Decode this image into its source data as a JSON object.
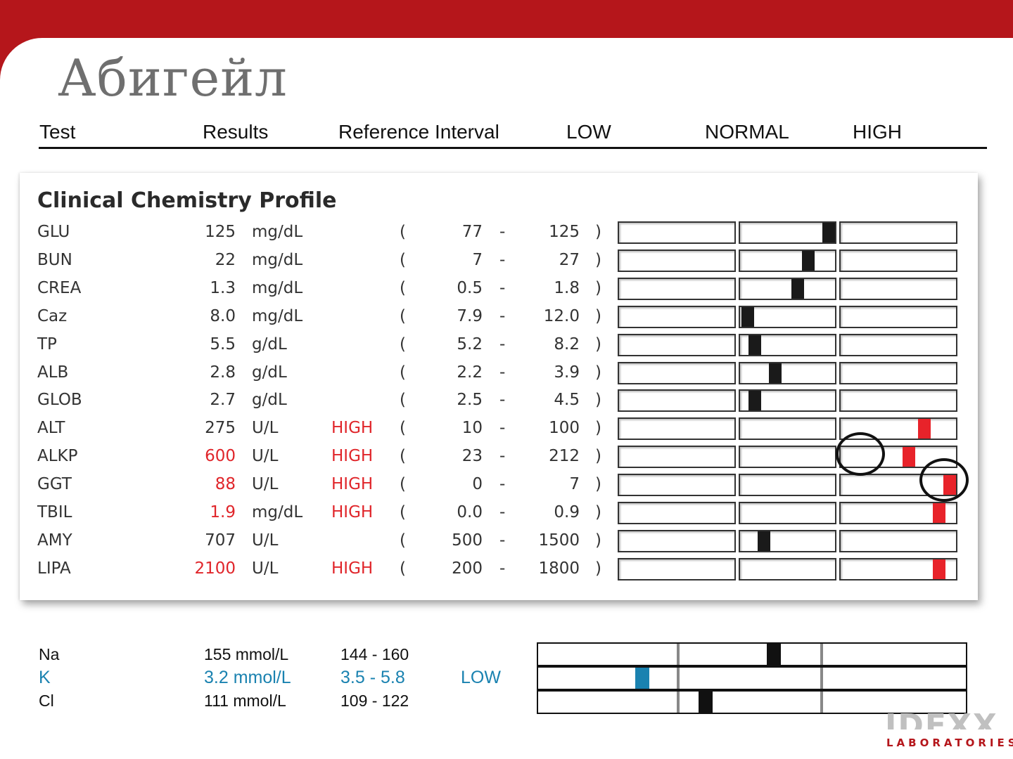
{
  "title": "Абигейл",
  "header": {
    "test": "Test",
    "results": "Results",
    "reference": "Reference Interval",
    "low": "LOW",
    "normal": "NORMAL",
    "high": "HIGH"
  },
  "profile": {
    "title": "Clinical Chemistry Profile",
    "rows": [
      {
        "test": "GLU",
        "result": "125",
        "unit": "mg/dL",
        "flag": "",
        "ref_open": "(",
        "ref_low": "77",
        "ref_dash": "-",
        "ref_high": "125",
        "ref_close": ")",
        "result_high": false,
        "level": 1.0
      },
      {
        "test": "BUN",
        "result": "22",
        "unit": "mg/dL",
        "flag": "",
        "ref_open": "(",
        "ref_low": "7",
        "ref_dash": "-",
        "ref_high": "27",
        "ref_close": ")",
        "result_high": false,
        "level": 0.75
      },
      {
        "test": "CREA",
        "result": "1.3",
        "unit": "mg/dL",
        "flag": "",
        "ref_open": "(",
        "ref_low": "0.5",
        "ref_dash": "-",
        "ref_high": "1.8",
        "ref_close": ")",
        "result_high": false,
        "level": 0.62
      },
      {
        "test": "Caz",
        "result": "8.0",
        "unit": "mg/dL",
        "flag": "",
        "ref_open": "(",
        "ref_low": "7.9",
        "ref_dash": "-",
        "ref_high": "12.0",
        "ref_close": ")",
        "result_high": false,
        "level": 0.02
      },
      {
        "test": "TP",
        "result": "5.5",
        "unit": "g/dL",
        "flag": "",
        "ref_open": "(",
        "ref_low": "5.2",
        "ref_dash": "-",
        "ref_high": "8.2",
        "ref_close": ")",
        "result_high": false,
        "level": 0.1
      },
      {
        "test": "ALB",
        "result": "2.8",
        "unit": "g/dL",
        "flag": "",
        "ref_open": "(",
        "ref_low": "2.2",
        "ref_dash": "-",
        "ref_high": "3.9",
        "ref_close": ")",
        "result_high": false,
        "level": 0.35
      },
      {
        "test": "GLOB",
        "result": "2.7",
        "unit": "g/dL",
        "flag": "",
        "ref_open": "(",
        "ref_low": "2.5",
        "ref_dash": "-",
        "ref_high": "4.5",
        "ref_close": ")",
        "result_high": false,
        "level": 0.1
      },
      {
        "test": "ALT",
        "result": "275",
        "unit": "U/L",
        "flag": "HIGH",
        "ref_open": "(",
        "ref_low": "10",
        "ref_dash": "-",
        "ref_high": "100",
        "ref_close": ")",
        "result_high": false,
        "level": 2.75
      },
      {
        "test": "ALKP",
        "result": "600",
        "unit": "U/L",
        "flag": "HIGH",
        "ref_open": "(",
        "ref_low": "23",
        "ref_dash": "-",
        "ref_high": "212",
        "ref_close": ")",
        "result_high": true,
        "level": 2.6
      },
      {
        "test": "GGT",
        "result": "88",
        "unit": "U/L",
        "flag": "HIGH",
        "ref_open": "(",
        "ref_low": "0",
        "ref_dash": "-",
        "ref_high": "7",
        "ref_close": ")",
        "result_high": true,
        "level": 3.0
      },
      {
        "test": "TBIL",
        "result": "1.9",
        "unit": "mg/dL",
        "flag": "HIGH",
        "ref_open": "(",
        "ref_low": "0.0",
        "ref_dash": "-",
        "ref_high": "0.9",
        "ref_close": ")",
        "result_high": true,
        "level": 2.9
      },
      {
        "test": "AMY",
        "result": "707",
        "unit": "U/L",
        "flag": "",
        "ref_open": "(",
        "ref_low": "500",
        "ref_dash": "-",
        "ref_high": "1500",
        "ref_close": ")",
        "result_high": false,
        "level": 0.21
      },
      {
        "test": "LIPA",
        "result": "2100",
        "unit": "U/L",
        "flag": "HIGH",
        "ref_open": "(",
        "ref_low": "200",
        "ref_dash": "-",
        "ref_high": "1800",
        "ref_close": ")",
        "result_high": true,
        "level": 2.9
      }
    ]
  },
  "electrolytes": [
    {
      "test": "Na",
      "result": "155 mmol/L",
      "reference": "144 - 160",
      "flag": "",
      "level": 0.69
    },
    {
      "test": "K",
      "result": "3.2 mmol/L",
      "reference": "3.5 - 5.8",
      "flag": "LOW",
      "level": 0.78
    },
    {
      "test": "Cl",
      "result": "111 mmol/L",
      "reference": "109 - 122",
      "flag": "",
      "level": 0.15
    }
  ],
  "logo": {
    "name": "IDEXX",
    "sub": "LABORATORIES"
  },
  "colors": {
    "brand_red": "#b5161b",
    "high_red": "#e0252a",
    "low_blue": "#1a82b0"
  }
}
